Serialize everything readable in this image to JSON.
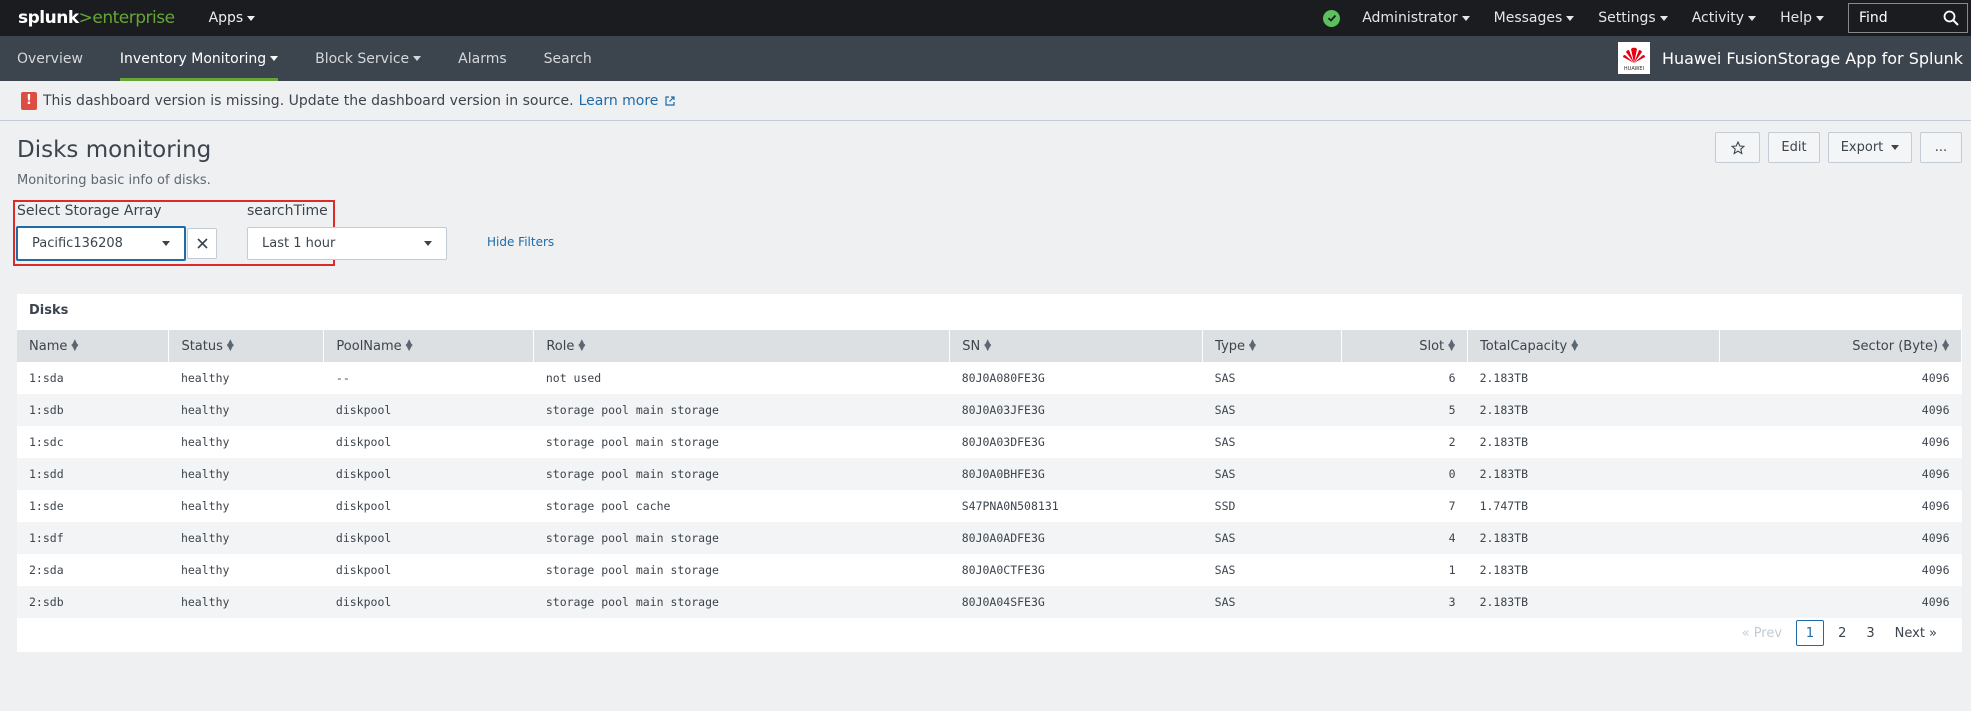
{
  "topbar": {
    "logo_main": "splunk",
    "logo_gt": ">",
    "logo_suffix": "enterprise",
    "apps": "Apps",
    "menu": [
      "Administrator",
      "Messages",
      "Settings",
      "Activity",
      "Help"
    ],
    "find_placeholder": "Find"
  },
  "appbar": {
    "nav": [
      "Overview",
      "Inventory Monitoring",
      "Block Service",
      "Alarms",
      "Search"
    ],
    "app_title": "Huawei FusionStorage App for Splunk",
    "logo_text": "HUAWEI"
  },
  "message": {
    "text": "This dashboard version is missing. Update the dashboard version in source.",
    "link": "Learn more"
  },
  "dashboard": {
    "title": "Disks monitoring",
    "description": "Monitoring basic info of disks.",
    "edit": "Edit",
    "export": "Export",
    "more": "..."
  },
  "filters": {
    "storage_label": "Select Storage Array",
    "storage_value": "Pacific136208",
    "time_label": "searchTime",
    "time_value": "Last 1 hour",
    "hide_filters": "Hide Filters"
  },
  "panel": {
    "title": "Disks",
    "columns": [
      "Name",
      "Status",
      "PoolName",
      "Role",
      "SN",
      "Type",
      "Slot",
      "TotalCapacity",
      "Sector (Byte)"
    ],
    "rows": [
      [
        "1:sda",
        "healthy",
        "--",
        "not used",
        "80J0A080FE3G",
        "SAS",
        "6",
        "2.183TB",
        "4096"
      ],
      [
        "1:sdb",
        "healthy",
        "diskpool",
        "storage pool main storage",
        "80J0A03JFE3G",
        "SAS",
        "5",
        "2.183TB",
        "4096"
      ],
      [
        "1:sdc",
        "healthy",
        "diskpool",
        "storage pool main storage",
        "80J0A03DFE3G",
        "SAS",
        "2",
        "2.183TB",
        "4096"
      ],
      [
        "1:sdd",
        "healthy",
        "diskpool",
        "storage pool main storage",
        "80J0A0BHFE3G",
        "SAS",
        "0",
        "2.183TB",
        "4096"
      ],
      [
        "1:sde",
        "healthy",
        "diskpool",
        "storage pool cache",
        "S47PNA0N508131",
        "SSD",
        "7",
        "1.747TB",
        "4096"
      ],
      [
        "1:sdf",
        "healthy",
        "diskpool",
        "storage pool main storage",
        "80J0A0ADFE3G",
        "SAS",
        "4",
        "2.183TB",
        "4096"
      ],
      [
        "2:sda",
        "healthy",
        "diskpool",
        "storage pool main storage",
        "80J0A0CTFE3G",
        "SAS",
        "1",
        "2.183TB",
        "4096"
      ],
      [
        "2:sdb",
        "healthy",
        "diskpool",
        "storage pool main storage",
        "80J0A04SFE3G",
        "SAS",
        "3",
        "2.183TB",
        "4096"
      ]
    ]
  },
  "pagination": {
    "prev": "« Prev",
    "pages": [
      "1",
      "2",
      "3"
    ],
    "next": "Next »"
  },
  "colors": {
    "accent_green": "#65a637",
    "link_blue": "#1e6ba8",
    "error_red": "#dc4e41"
  }
}
